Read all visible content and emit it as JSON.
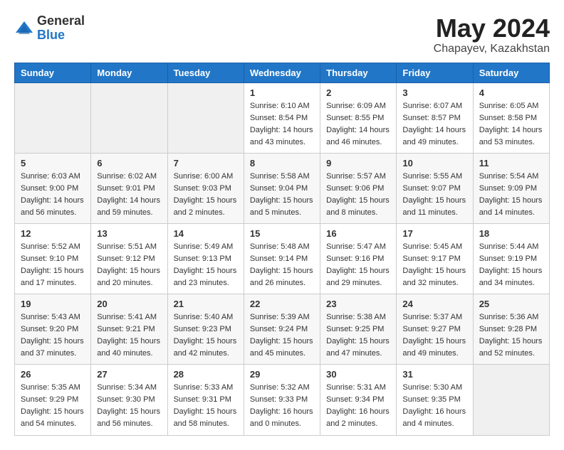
{
  "logo": {
    "general": "General",
    "blue": "Blue"
  },
  "title": "May 2024",
  "location": "Chapayev, Kazakhstan",
  "weekdays": [
    "Sunday",
    "Monday",
    "Tuesday",
    "Wednesday",
    "Thursday",
    "Friday",
    "Saturday"
  ],
  "weeks": [
    [
      {
        "day": "",
        "info": ""
      },
      {
        "day": "",
        "info": ""
      },
      {
        "day": "",
        "info": ""
      },
      {
        "day": "1",
        "info": "Sunrise: 6:10 AM\nSunset: 8:54 PM\nDaylight: 14 hours\nand 43 minutes."
      },
      {
        "day": "2",
        "info": "Sunrise: 6:09 AM\nSunset: 8:55 PM\nDaylight: 14 hours\nand 46 minutes."
      },
      {
        "day": "3",
        "info": "Sunrise: 6:07 AM\nSunset: 8:57 PM\nDaylight: 14 hours\nand 49 minutes."
      },
      {
        "day": "4",
        "info": "Sunrise: 6:05 AM\nSunset: 8:58 PM\nDaylight: 14 hours\nand 53 minutes."
      }
    ],
    [
      {
        "day": "5",
        "info": "Sunrise: 6:03 AM\nSunset: 9:00 PM\nDaylight: 14 hours\nand 56 minutes."
      },
      {
        "day": "6",
        "info": "Sunrise: 6:02 AM\nSunset: 9:01 PM\nDaylight: 14 hours\nand 59 minutes."
      },
      {
        "day": "7",
        "info": "Sunrise: 6:00 AM\nSunset: 9:03 PM\nDaylight: 15 hours\nand 2 minutes."
      },
      {
        "day": "8",
        "info": "Sunrise: 5:58 AM\nSunset: 9:04 PM\nDaylight: 15 hours\nand 5 minutes."
      },
      {
        "day": "9",
        "info": "Sunrise: 5:57 AM\nSunset: 9:06 PM\nDaylight: 15 hours\nand 8 minutes."
      },
      {
        "day": "10",
        "info": "Sunrise: 5:55 AM\nSunset: 9:07 PM\nDaylight: 15 hours\nand 11 minutes."
      },
      {
        "day": "11",
        "info": "Sunrise: 5:54 AM\nSunset: 9:09 PM\nDaylight: 15 hours\nand 14 minutes."
      }
    ],
    [
      {
        "day": "12",
        "info": "Sunrise: 5:52 AM\nSunset: 9:10 PM\nDaylight: 15 hours\nand 17 minutes."
      },
      {
        "day": "13",
        "info": "Sunrise: 5:51 AM\nSunset: 9:12 PM\nDaylight: 15 hours\nand 20 minutes."
      },
      {
        "day": "14",
        "info": "Sunrise: 5:49 AM\nSunset: 9:13 PM\nDaylight: 15 hours\nand 23 minutes."
      },
      {
        "day": "15",
        "info": "Sunrise: 5:48 AM\nSunset: 9:14 PM\nDaylight: 15 hours\nand 26 minutes."
      },
      {
        "day": "16",
        "info": "Sunrise: 5:47 AM\nSunset: 9:16 PM\nDaylight: 15 hours\nand 29 minutes."
      },
      {
        "day": "17",
        "info": "Sunrise: 5:45 AM\nSunset: 9:17 PM\nDaylight: 15 hours\nand 32 minutes."
      },
      {
        "day": "18",
        "info": "Sunrise: 5:44 AM\nSunset: 9:19 PM\nDaylight: 15 hours\nand 34 minutes."
      }
    ],
    [
      {
        "day": "19",
        "info": "Sunrise: 5:43 AM\nSunset: 9:20 PM\nDaylight: 15 hours\nand 37 minutes."
      },
      {
        "day": "20",
        "info": "Sunrise: 5:41 AM\nSunset: 9:21 PM\nDaylight: 15 hours\nand 40 minutes."
      },
      {
        "day": "21",
        "info": "Sunrise: 5:40 AM\nSunset: 9:23 PM\nDaylight: 15 hours\nand 42 minutes."
      },
      {
        "day": "22",
        "info": "Sunrise: 5:39 AM\nSunset: 9:24 PM\nDaylight: 15 hours\nand 45 minutes."
      },
      {
        "day": "23",
        "info": "Sunrise: 5:38 AM\nSunset: 9:25 PM\nDaylight: 15 hours\nand 47 minutes."
      },
      {
        "day": "24",
        "info": "Sunrise: 5:37 AM\nSunset: 9:27 PM\nDaylight: 15 hours\nand 49 minutes."
      },
      {
        "day": "25",
        "info": "Sunrise: 5:36 AM\nSunset: 9:28 PM\nDaylight: 15 hours\nand 52 minutes."
      }
    ],
    [
      {
        "day": "26",
        "info": "Sunrise: 5:35 AM\nSunset: 9:29 PM\nDaylight: 15 hours\nand 54 minutes."
      },
      {
        "day": "27",
        "info": "Sunrise: 5:34 AM\nSunset: 9:30 PM\nDaylight: 15 hours\nand 56 minutes."
      },
      {
        "day": "28",
        "info": "Sunrise: 5:33 AM\nSunset: 9:31 PM\nDaylight: 15 hours\nand 58 minutes."
      },
      {
        "day": "29",
        "info": "Sunrise: 5:32 AM\nSunset: 9:33 PM\nDaylight: 16 hours\nand 0 minutes."
      },
      {
        "day": "30",
        "info": "Sunrise: 5:31 AM\nSunset: 9:34 PM\nDaylight: 16 hours\nand 2 minutes."
      },
      {
        "day": "31",
        "info": "Sunrise: 5:30 AM\nSunset: 9:35 PM\nDaylight: 16 hours\nand 4 minutes."
      },
      {
        "day": "",
        "info": ""
      }
    ]
  ]
}
